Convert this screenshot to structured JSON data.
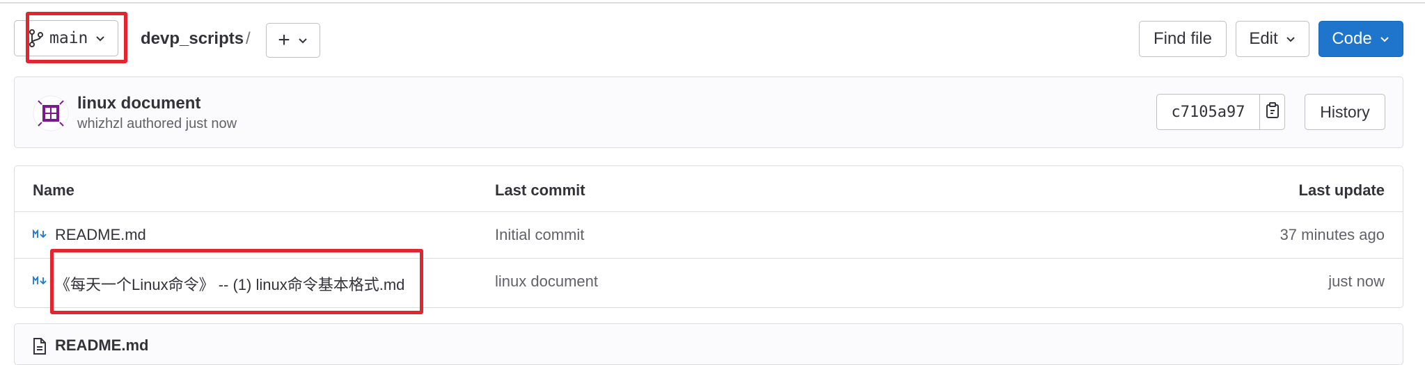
{
  "toolbar": {
    "branch": "main",
    "repo_name": "devp_scripts",
    "separator": "/",
    "add_label": "+",
    "find_file": "Find file",
    "edit": "Edit",
    "code": "Code"
  },
  "last_commit": {
    "title": "linux document",
    "meta": "whizhzl authored just now",
    "sha": "c7105a97",
    "history": "History"
  },
  "table": {
    "headers": {
      "name": "Name",
      "last_commit": "Last commit",
      "last_update": "Last update"
    },
    "rows": [
      {
        "name": "README.md",
        "commit": "Initial commit",
        "updated": "37 minutes ago",
        "icon": "markdown-icon"
      },
      {
        "name": "《每天一个Linux命令》 -- (1) linux命令基本格式.md",
        "commit": "linux document",
        "updated": "just now",
        "icon": "markdown-icon"
      }
    ]
  },
  "readme": {
    "title": "README.md"
  },
  "colors": {
    "primary": "#1f75cb",
    "highlight": "#e3252f",
    "avatar": "#7a1b8c"
  }
}
